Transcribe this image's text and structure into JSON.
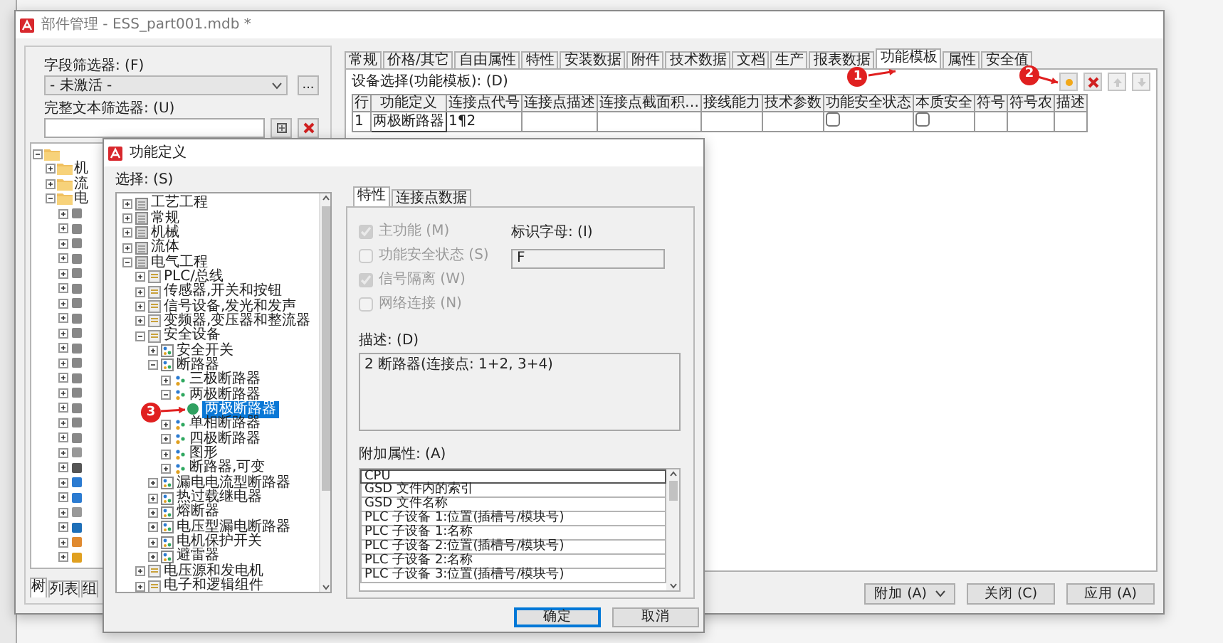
{
  "main_window": {
    "title": "部件管理 - ESS_part001.mdb *",
    "left_panel": {
      "field_filter_label": "字段筛选器: (F)",
      "field_filter_value": "- 未激活 -",
      "more_button": "...",
      "fulltext_label": "完整文本筛选器: (U)",
      "tree": [
        {
          "expanded": true,
          "children": [
            {
              "label": "机",
              "expanded": false
            },
            {
              "label": "流",
              "expanded": false
            },
            {
              "label": "电",
              "expanded": true
            }
          ]
        }
      ],
      "bottom_tabs": [
        {
          "label": "树",
          "selected": true
        },
        {
          "label": "列表",
          "selected": false
        },
        {
          "label": "组",
          "selected": false
        }
      ]
    },
    "tabs": [
      {
        "label": "常规",
        "selected": false
      },
      {
        "label": "价格/其它",
        "selected": false
      },
      {
        "label": "自由属性",
        "selected": false
      },
      {
        "label": "特性",
        "selected": false
      },
      {
        "label": "安装数据",
        "selected": false
      },
      {
        "label": "附件",
        "selected": false
      },
      {
        "label": "技术数据",
        "selected": false
      },
      {
        "label": "文档",
        "selected": false
      },
      {
        "label": "生产",
        "selected": false
      },
      {
        "label": "报表数据",
        "selected": false
      },
      {
        "label": "功能模板",
        "selected": true
      },
      {
        "label": "属性",
        "selected": false
      },
      {
        "label": "安全值",
        "selected": false
      }
    ],
    "device_label": "设备选择(功能模板): (D)",
    "toolbar": [
      {
        "kind": "add",
        "disabled": false
      },
      {
        "kind": "delete",
        "disabled": false
      },
      {
        "kind": "up",
        "disabled": true
      },
      {
        "kind": "down",
        "disabled": true
      }
    ],
    "table": {
      "columns": [
        "行",
        "功能定义",
        "连接点代号",
        "连接点描述",
        "连接点截面积…",
        "接线能力",
        "技术参数",
        "功能安全状态",
        "本质安全",
        "符号",
        "符号农",
        "描述"
      ],
      "rows": [
        {
          "row": "1",
          "function": "两极断路器",
          "connection": "1¶2",
          "safety_state": false,
          "intrinsic_safety": false
        }
      ]
    },
    "buttons": [
      {
        "label": "附加 (A)",
        "kind": "dropdown"
      },
      {
        "label": "关闭 (C)",
        "kind": "plain"
      },
      {
        "label": "应用 (A)",
        "kind": "plain"
      }
    ]
  },
  "dialog": {
    "title": "功能定义",
    "select_label": "选择: (S)",
    "tree": [
      {
        "label": "工艺工程",
        "kind": "category",
        "expanded": false
      },
      {
        "label": "常规",
        "kind": "category",
        "expanded": false
      },
      {
        "label": "机械",
        "kind": "category",
        "expanded": false
      },
      {
        "label": "流体",
        "kind": "category",
        "expanded": false
      },
      {
        "label": "电气工程",
        "kind": "category",
        "expanded": true,
        "children": [
          {
            "label": "PLC/总线",
            "kind": "group",
            "expanded": false
          },
          {
            "label": "传感器,开关和按钮",
            "kind": "group",
            "expanded": false
          },
          {
            "label": "信号设备,发光和发声",
            "kind": "group",
            "expanded": false
          },
          {
            "label": "变频器,变压器和整流器",
            "kind": "group",
            "expanded": false
          },
          {
            "label": "安全设备",
            "kind": "group",
            "expanded": true,
            "children": [
              {
                "label": "安全开关",
                "kind": "set",
                "expanded": false
              },
              {
                "label": "断路器",
                "kind": "set",
                "expanded": true,
                "children": [
                  {
                    "label": "三极断路器",
                    "kind": "function",
                    "expanded": false
                  },
                  {
                    "label": "两极断路器",
                    "kind": "function",
                    "expanded": true,
                    "children": [
                      {
                        "label": "两极断路器",
                        "kind": "variant",
                        "selected": true
                      }
                    ]
                  },
                  {
                    "label": "单相断路器",
                    "kind": "function",
                    "expanded": false
                  },
                  {
                    "label": "四极断路器",
                    "kind": "function",
                    "expanded": false
                  },
                  {
                    "label": "图形",
                    "kind": "function",
                    "expanded": false
                  },
                  {
                    "label": "断路器,可变",
                    "kind": "function",
                    "expanded": false
                  }
                ]
              },
              {
                "label": "漏电电流型断路器",
                "kind": "set",
                "expanded": false
              },
              {
                "label": "热过载继电器",
                "kind": "set",
                "expanded": false
              },
              {
                "label": "熔断器",
                "kind": "set",
                "expanded": false
              },
              {
                "label": "电压型漏电断路器",
                "kind": "set",
                "expanded": false
              },
              {
                "label": "电机保护开关",
                "kind": "set",
                "expanded": false
              },
              {
                "label": "避雷器",
                "kind": "set",
                "expanded": false
              }
            ]
          },
          {
            "label": "电压源和发电机",
            "kind": "group",
            "expanded": false
          },
          {
            "label": "电子和逻辑组件",
            "kind": "group",
            "expanded": false
          }
        ]
      }
    ],
    "tabs": [
      {
        "label": "特性",
        "selected": true
      },
      {
        "label": "连接点数据",
        "selected": false
      }
    ],
    "checkboxes": [
      {
        "label": "主功能 (M)",
        "checked": true,
        "disabled": true
      },
      {
        "label": "功能安全状态 (S)",
        "checked": false,
        "disabled": true
      },
      {
        "label": "信号隔离 (W)",
        "checked": true,
        "disabled": true
      },
      {
        "label": "网络连接 (N)",
        "checked": false,
        "disabled": true
      }
    ],
    "id_letter_label": "标识字母: (I)",
    "id_letter_value": "F",
    "description_label": "描述: (D)",
    "description": "2 断路器(连接点: 1+2, 3+4)",
    "extra_label": "附加属性: (A)",
    "extra_items": [
      {
        "label": "CPU",
        "selected": true
      },
      {
        "label": "GSD 文件内的索引",
        "selected": false
      },
      {
        "label": "GSD 文件名称",
        "selected": false
      },
      {
        "label": "PLC 子设备 1:位置(插槽号/模块号)",
        "selected": false
      },
      {
        "label": "PLC 子设备 1:名称",
        "selected": false
      },
      {
        "label": "PLC 子设备 2:位置(插槽号/模块号)",
        "selected": false
      },
      {
        "label": "PLC 子设备 2:名称",
        "selected": false
      },
      {
        "label": "PLC 子设备 3:位置(插槽号/模块号)",
        "selected": false
      }
    ],
    "buttons": [
      {
        "label": "确定",
        "default": true
      },
      {
        "label": "取消",
        "default": false
      }
    ]
  },
  "annotations": [
    {
      "label": "1"
    },
    {
      "label": "2"
    },
    {
      "label": "3"
    }
  ]
}
